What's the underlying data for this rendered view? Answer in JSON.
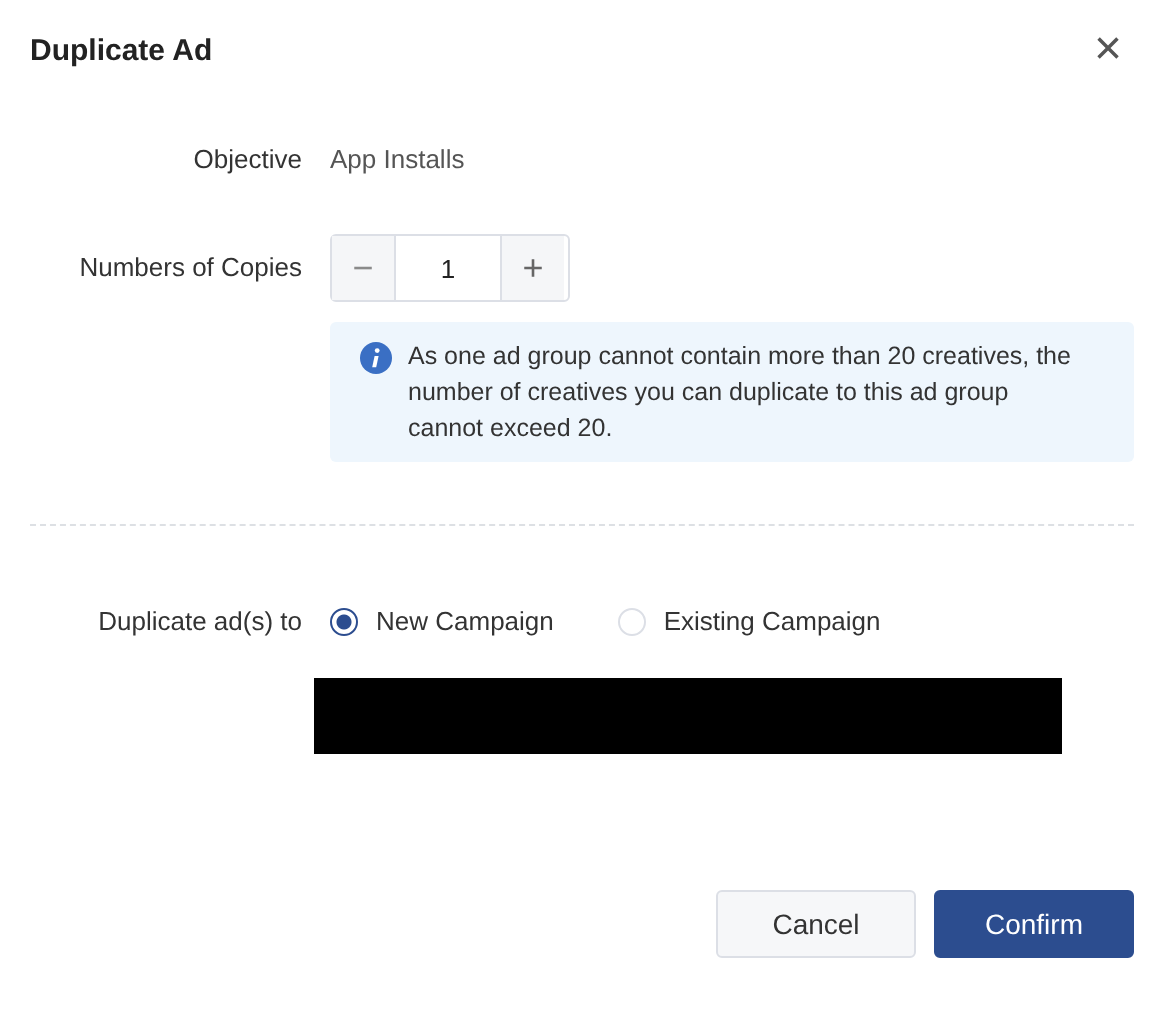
{
  "dialog": {
    "title": "Duplicate Ad",
    "close": "×"
  },
  "objective": {
    "label": "Objective",
    "value": "App Installs"
  },
  "copies": {
    "label": "Numbers of Copies",
    "decrement": "−",
    "value": "1",
    "increment": "+",
    "decrement_disabled": true
  },
  "notice": "As one ad group cannot contain more than 20 creatives, the number of creatives you can duplicate to this ad group cannot exceed 20.",
  "destination": {
    "label": "Duplicate ad(s) to",
    "options": [
      {
        "label": "New Campaign",
        "selected": true
      },
      {
        "label": "Existing Campaign",
        "selected": false
      }
    ]
  },
  "buttons": [
    {
      "label": "Cancel",
      "kind": "secondary"
    },
    {
      "label": "Confirm",
      "kind": "primary"
    }
  ]
}
